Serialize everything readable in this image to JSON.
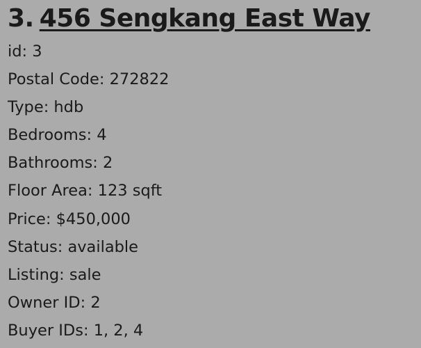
{
  "listing": {
    "number": "3.",
    "address": "456 Sengkang East Way",
    "fields": [
      {
        "label": "id",
        "value": "3"
      },
      {
        "label": "Postal Code",
        "value": "272822"
      },
      {
        "label": "Type",
        "value": "hdb"
      },
      {
        "label": "Bedrooms",
        "value": "4"
      },
      {
        "label": "Bathrooms",
        "value": "2"
      },
      {
        "label": "Floor Area",
        "value": "123 sqft"
      },
      {
        "label": "Price",
        "value": "$450,000"
      },
      {
        "label": "Status",
        "value": "available"
      },
      {
        "label": "Listing",
        "value": "sale"
      },
      {
        "label": "Owner ID",
        "value": "2"
      },
      {
        "label": "Buyer IDs",
        "value": "1, 2, 4"
      }
    ]
  }
}
